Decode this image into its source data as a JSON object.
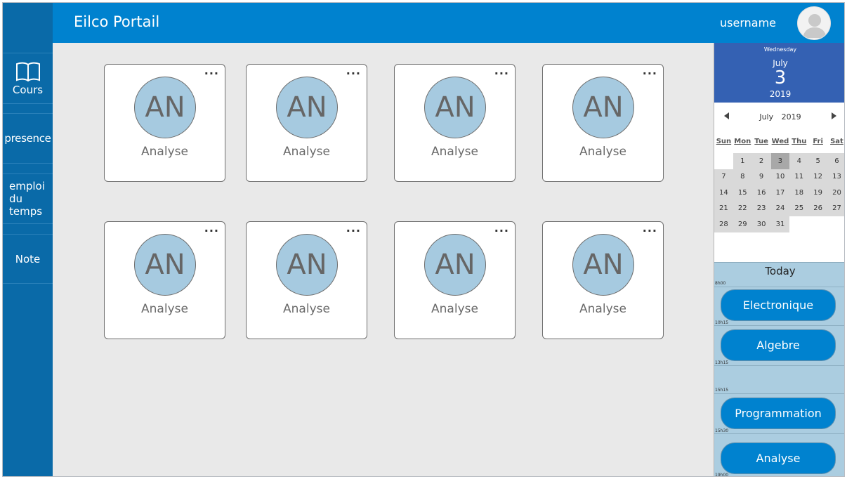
{
  "header": {
    "title": "Eilco Portail",
    "username": "username"
  },
  "sidebar": {
    "items": [
      {
        "label": "Cours"
      },
      {
        "label": "presence"
      },
      {
        "label": "emploi du temps"
      },
      {
        "label": "Note"
      }
    ]
  },
  "cards": [
    {
      "initials": "AN",
      "label": "Analyse",
      "menu": "..."
    },
    {
      "initials": "AN",
      "label": "Analyse",
      "menu": "..."
    },
    {
      "initials": "AN",
      "label": "Analyse",
      "menu": "..."
    },
    {
      "initials": "AN",
      "label": "Analyse",
      "menu": "..."
    },
    {
      "initials": "AN",
      "label": "Analyse",
      "menu": "..."
    },
    {
      "initials": "AN",
      "label": "Analyse",
      "menu": "..."
    },
    {
      "initials": "AN",
      "label": "Analyse",
      "menu": "..."
    },
    {
      "initials": "AN",
      "label": "Analyse",
      "menu": "..."
    }
  ],
  "calendar": {
    "weekday": "Wednesday",
    "month": "July",
    "day": "3",
    "year": "2019",
    "nav_month": "July",
    "nav_year": "2019",
    "dow": [
      "Sun",
      "Mon",
      "Tue",
      "Wed",
      "Thu",
      "Fri",
      "Sat"
    ],
    "days": [
      "1",
      "2",
      "3",
      "4",
      "5",
      "6",
      "7",
      "8",
      "9",
      "10",
      "11",
      "12",
      "13",
      "14",
      "15",
      "16",
      "17",
      "18",
      "19",
      "20",
      "21",
      "22",
      "23",
      "24",
      "25",
      "26",
      "27",
      "28",
      "29",
      "30",
      "31"
    ],
    "selected": "3"
  },
  "today": {
    "title": "Today",
    "times": [
      "8h00",
      "10h15",
      "13h15",
      "15h15",
      "15h30",
      "19h00"
    ],
    "events": [
      {
        "label": "Electronique"
      },
      {
        "label": "Algebre"
      },
      {
        "label": "Programmation"
      },
      {
        "label": "Analyse"
      }
    ]
  },
  "colors": {
    "sidebar": "#0a6aa8",
    "header": "#0082cf",
    "calendar_header": "#3461b3",
    "card_circle": "#a6cae0",
    "today_panel": "#abcde0"
  }
}
